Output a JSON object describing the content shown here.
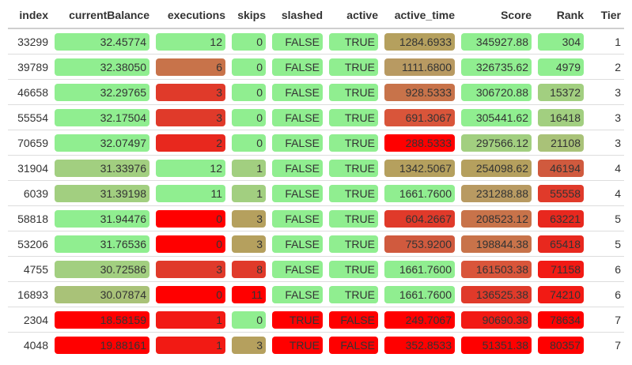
{
  "columns": [
    "index",
    "currentBalance",
    "executions",
    "skips",
    "slashed",
    "active",
    "active_time",
    "Score",
    "Rank",
    "Tier"
  ],
  "colors": {
    "green": "#90EE90",
    "olive_green": "#A2CF80",
    "olive": "#B5A05E",
    "tan": "#B89A62",
    "brown_orange": "#C8734A",
    "red_orange": "#D9553A",
    "dark_red": "#E03A2A",
    "red": "#FF0000"
  },
  "rows": [
    {
      "index": "33299",
      "currentBalance": {
        "text": "32.45774",
        "color": "#90EE90"
      },
      "executions": {
        "text": "12",
        "color": "#90EE90"
      },
      "skips": {
        "text": "0",
        "color": "#90EE90"
      },
      "slashed": {
        "text": "FALSE",
        "color": "#90EE90"
      },
      "active": {
        "text": "TRUE",
        "color": "#90EE90"
      },
      "active_time": {
        "text": "1284.6933",
        "color": "#B5A05E"
      },
      "Score": {
        "text": "345927.88",
        "color": "#90EE90"
      },
      "Rank": {
        "text": "304",
        "color": "#90EE90"
      },
      "Tier": "1"
    },
    {
      "index": "39789",
      "currentBalance": {
        "text": "32.38050",
        "color": "#90EE90"
      },
      "executions": {
        "text": "6",
        "color": "#C8734A"
      },
      "skips": {
        "text": "0",
        "color": "#90EE90"
      },
      "slashed": {
        "text": "FALSE",
        "color": "#90EE90"
      },
      "active": {
        "text": "TRUE",
        "color": "#90EE90"
      },
      "active_time": {
        "text": "1111.6800",
        "color": "#B89A62"
      },
      "Score": {
        "text": "326735.62",
        "color": "#90EE90"
      },
      "Rank": {
        "text": "4979",
        "color": "#90EE90"
      },
      "Tier": "2"
    },
    {
      "index": "46658",
      "currentBalance": {
        "text": "32.29765",
        "color": "#90EE90"
      },
      "executions": {
        "text": "3",
        "color": "#E03A2A"
      },
      "skips": {
        "text": "0",
        "color": "#90EE90"
      },
      "slashed": {
        "text": "FALSE",
        "color": "#90EE90"
      },
      "active": {
        "text": "TRUE",
        "color": "#90EE90"
      },
      "active_time": {
        "text": "928.5333",
        "color": "#C8734A"
      },
      "Score": {
        "text": "306720.88",
        "color": "#90EE90"
      },
      "Rank": {
        "text": "15372",
        "color": "#A2CF80"
      },
      "Tier": "3"
    },
    {
      "index": "55554",
      "currentBalance": {
        "text": "32.17504",
        "color": "#90EE90"
      },
      "executions": {
        "text": "3",
        "color": "#E03A2A"
      },
      "skips": {
        "text": "0",
        "color": "#90EE90"
      },
      "slashed": {
        "text": "FALSE",
        "color": "#90EE90"
      },
      "active": {
        "text": "TRUE",
        "color": "#90EE90"
      },
      "active_time": {
        "text": "691.3067",
        "color": "#D9553A"
      },
      "Score": {
        "text": "305441.62",
        "color": "#90EE90"
      },
      "Rank": {
        "text": "16418",
        "color": "#A2CF80"
      },
      "Tier": "3"
    },
    {
      "index": "70659",
      "currentBalance": {
        "text": "32.07497",
        "color": "#90EE90"
      },
      "executions": {
        "text": "2",
        "color": "#E8281E"
      },
      "skips": {
        "text": "0",
        "color": "#90EE90"
      },
      "slashed": {
        "text": "FALSE",
        "color": "#90EE90"
      },
      "active": {
        "text": "TRUE",
        "color": "#90EE90"
      },
      "active_time": {
        "text": "288.5333",
        "color": "#FF0000"
      },
      "Score": {
        "text": "297566.12",
        "color": "#A2CF80"
      },
      "Rank": {
        "text": "21108",
        "color": "#A9C278"
      },
      "Tier": "3"
    },
    {
      "index": "31904",
      "currentBalance": {
        "text": "31.33976",
        "color": "#A2CF80"
      },
      "executions": {
        "text": "12",
        "color": "#90EE90"
      },
      "skips": {
        "text": "1",
        "color": "#A2CF80"
      },
      "slashed": {
        "text": "FALSE",
        "color": "#90EE90"
      },
      "active": {
        "text": "TRUE",
        "color": "#90EE90"
      },
      "active_time": {
        "text": "1342.5067",
        "color": "#B5A05E"
      },
      "Score": {
        "text": "254098.62",
        "color": "#B5A05E"
      },
      "Rank": {
        "text": "46194",
        "color": "#D05A3E"
      },
      "Tier": "4"
    },
    {
      "index": "6039",
      "currentBalance": {
        "text": "31.39198",
        "color": "#A2CF80"
      },
      "executions": {
        "text": "11",
        "color": "#90EE90"
      },
      "skips": {
        "text": "1",
        "color": "#A2CF80"
      },
      "slashed": {
        "text": "FALSE",
        "color": "#90EE90"
      },
      "active": {
        "text": "TRUE",
        "color": "#90EE90"
      },
      "active_time": {
        "text": "1661.7600",
        "color": "#90EE90"
      },
      "Score": {
        "text": "231288.88",
        "color": "#B89A62"
      },
      "Rank": {
        "text": "55558",
        "color": "#E03A2A"
      },
      "Tier": "4"
    },
    {
      "index": "58818",
      "currentBalance": {
        "text": "31.94476",
        "color": "#90EE90"
      },
      "executions": {
        "text": "0",
        "color": "#FF0000"
      },
      "skips": {
        "text": "3",
        "color": "#B5A05E"
      },
      "slashed": {
        "text": "FALSE",
        "color": "#90EE90"
      },
      "active": {
        "text": "TRUE",
        "color": "#90EE90"
      },
      "active_time": {
        "text": "604.2667",
        "color": "#E03A2A"
      },
      "Score": {
        "text": "208523.12",
        "color": "#C8734A"
      },
      "Rank": {
        "text": "63221",
        "color": "#E8281E"
      },
      "Tier": "5"
    },
    {
      "index": "53206",
      "currentBalance": {
        "text": "31.76536",
        "color": "#90EE90"
      },
      "executions": {
        "text": "0",
        "color": "#FF0000"
      },
      "skips": {
        "text": "3",
        "color": "#B5A05E"
      },
      "slashed": {
        "text": "FALSE",
        "color": "#90EE90"
      },
      "active": {
        "text": "TRUE",
        "color": "#90EE90"
      },
      "active_time": {
        "text": "753.9200",
        "color": "#D05A3E"
      },
      "Score": {
        "text": "198844.38",
        "color": "#C8734A"
      },
      "Rank": {
        "text": "65418",
        "color": "#E8281E"
      },
      "Tier": "5"
    },
    {
      "index": "4755",
      "currentBalance": {
        "text": "30.72586",
        "color": "#A2CF80"
      },
      "executions": {
        "text": "3",
        "color": "#E03A2A"
      },
      "skips": {
        "text": "8",
        "color": "#E03A2A"
      },
      "slashed": {
        "text": "FALSE",
        "color": "#90EE90"
      },
      "active": {
        "text": "TRUE",
        "color": "#90EE90"
      },
      "active_time": {
        "text": "1661.7600",
        "color": "#90EE90"
      },
      "Score": {
        "text": "161503.38",
        "color": "#D9553A"
      },
      "Rank": {
        "text": "71158",
        "color": "#F21A14"
      },
      "Tier": "6"
    },
    {
      "index": "16893",
      "currentBalance": {
        "text": "30.07874",
        "color": "#A9C278"
      },
      "executions": {
        "text": "0",
        "color": "#FF0000"
      },
      "skips": {
        "text": "11",
        "color": "#FF0000"
      },
      "slashed": {
        "text": "FALSE",
        "color": "#90EE90"
      },
      "active": {
        "text": "TRUE",
        "color": "#90EE90"
      },
      "active_time": {
        "text": "1661.7600",
        "color": "#90EE90"
      },
      "Score": {
        "text": "136525.38",
        "color": "#E03A2A"
      },
      "Rank": {
        "text": "74210",
        "color": "#F21A14"
      },
      "Tier": "6"
    },
    {
      "index": "2304",
      "currentBalance": {
        "text": "18.58159",
        "color": "#FF0000"
      },
      "executions": {
        "text": "1",
        "color": "#F21A14"
      },
      "skips": {
        "text": "0",
        "color": "#90EE90"
      },
      "slashed": {
        "text": "TRUE",
        "color": "#FF0000"
      },
      "active": {
        "text": "FALSE",
        "color": "#FF0000"
      },
      "active_time": {
        "text": "249.7067",
        "color": "#FF0000"
      },
      "Score": {
        "text": "90690.38",
        "color": "#F21A14"
      },
      "Rank": {
        "text": "78634",
        "color": "#FF0000"
      },
      "Tier": "7"
    },
    {
      "index": "4048",
      "currentBalance": {
        "text": "19.88161",
        "color": "#FF0000"
      },
      "executions": {
        "text": "1",
        "color": "#F21A14"
      },
      "skips": {
        "text": "3",
        "color": "#B5A05E"
      },
      "slashed": {
        "text": "TRUE",
        "color": "#FF0000"
      },
      "active": {
        "text": "FALSE",
        "color": "#FF0000"
      },
      "active_time": {
        "text": "352.8533",
        "color": "#FF0000"
      },
      "Score": {
        "text": "51351.38",
        "color": "#FF0000"
      },
      "Rank": {
        "text": "80357",
        "color": "#FF0000"
      },
      "Tier": "7"
    }
  ]
}
